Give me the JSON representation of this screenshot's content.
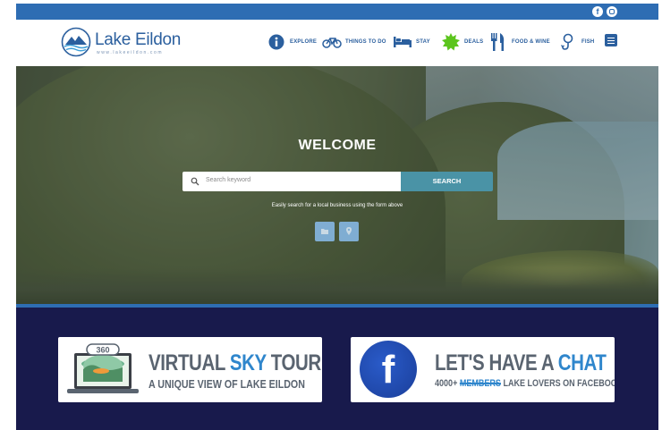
{
  "topbar": {
    "facebook_glyph": "f",
    "icons": [
      "facebook-icon",
      "instagram-icon"
    ]
  },
  "header": {
    "logo_title": "Lake Eildon",
    "logo_subtitle": "www.lakeeildon.com",
    "nav": [
      {
        "label": "EXPLORE",
        "icon": "info-icon"
      },
      {
        "label": "THINGS TO DO",
        "icon": "bicycle-icon"
      },
      {
        "label": "STAY",
        "icon": "bed-icon"
      },
      {
        "label": "DEALS",
        "icon": "starburst-icon"
      },
      {
        "label": "FOOD & WINE",
        "icon": "fork-knife-icon"
      },
      {
        "label": "FISH",
        "icon": "fish-hook-icon"
      }
    ],
    "menu_icon": "hamburger-menu-icon"
  },
  "hero": {
    "title": "WELCOME",
    "search_placeholder": "Search keyword",
    "search_button": "SEARCH",
    "hint": "Easily search for a local business using the form above",
    "mini_buttons": [
      "folder-icon",
      "map-pin-icon"
    ]
  },
  "cards": {
    "tour": {
      "badge": "360",
      "title_part1": "VIRTUAL ",
      "title_highlight": "SKY",
      "title_part2": " TOUR",
      "subtitle": "A UNIQUE VIEW OF LAKE EILDON"
    },
    "chat": {
      "fb_glyph": "f",
      "title_part1": "LET'S HAVE A ",
      "title_highlight": "CHAT",
      "subtitle_prefix": "4000+ ",
      "subtitle_struck": "MEMBERS",
      "subtitle_suffix": " LAKE LOVERS ON FACEBOOK"
    }
  },
  "colors": {
    "accent_blue": "#2e6db3",
    "logo_blue": "#2b5f9e",
    "search_teal": "#4a93a6",
    "navy_section": "#181a4c",
    "deals_green": "#5cc51d",
    "highlight_blue": "#2f86cc"
  }
}
